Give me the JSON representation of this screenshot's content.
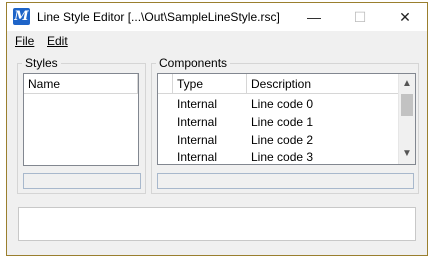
{
  "window": {
    "title": "Line Style Editor [...\\Out\\SampleLineStyle.rsc]",
    "minimize_glyph": "—",
    "maximize_glyph": "☐",
    "close_glyph": "✕",
    "app_icon_glyph": "M"
  },
  "menu": {
    "file": "File",
    "edit": "Edit"
  },
  "styles": {
    "group_label": "Styles",
    "column_name": "Name"
  },
  "components": {
    "group_label": "Components",
    "columns": {
      "type": "Type",
      "description": "Description"
    },
    "rows": [
      {
        "type": "Internal",
        "description": "Line code 0"
      },
      {
        "type": "Internal",
        "description": "Line code 1"
      },
      {
        "type": "Internal",
        "description": "Line code 2"
      },
      {
        "type": "Internal",
        "description": "Line code 3"
      }
    ],
    "scroll_up_glyph": "▲",
    "scroll_down_glyph": "▼"
  }
}
